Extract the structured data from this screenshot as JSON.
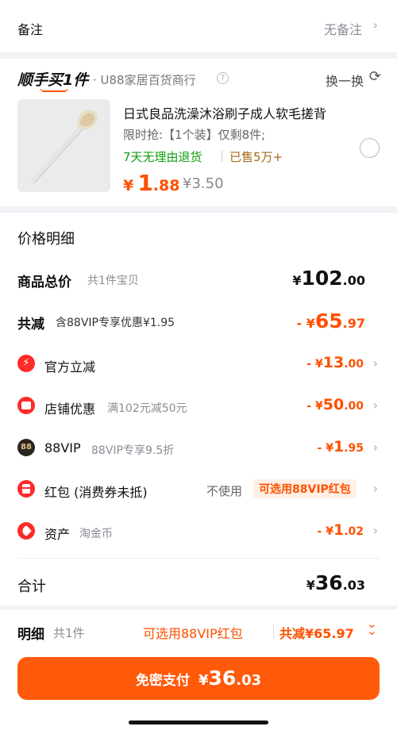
{
  "remark": {
    "label": "备注",
    "value": "无备注"
  },
  "store": {
    "logo_text": "顺手买1件",
    "name": "· U88家居百货商行",
    "swap_label": "换一换"
  },
  "product": {
    "title": "日式良品洗澡沐浴刷子成人软毛搓背",
    "promo": "限时抢:【1个装】仅剩8件;",
    "return_policy": "7天无理由退货",
    "sold": "已售5万+",
    "price_symbol": "¥",
    "price_int": "1",
    "price_dec": ".88",
    "original_price": "¥3.50"
  },
  "price_detail": {
    "heading": "价格明细",
    "total_label": "商品总价",
    "total_sub": "共1件宝贝",
    "total_symbol": "¥",
    "total_int": "102",
    "total_dec": ".00",
    "reduce_label": "共减",
    "reduce_sub": "含88VIP专享优惠¥1.95",
    "reduce_prefix": "- ¥",
    "reduce_int": "65",
    "reduce_dec": ".97",
    "official_label": "官方立减",
    "official_prefix": "- ¥",
    "official_int": "13",
    "official_dec": ".00",
    "shop_label": "店铺优惠",
    "shop_sub": "满102元减50元",
    "shop_prefix": "- ¥",
    "shop_int": "50",
    "shop_dec": ".00",
    "vip_badge": "88",
    "vip_label": "88VIP",
    "vip_sub": "88VIP专享9.5折",
    "vip_prefix": "- ¥",
    "vip_int": "1",
    "vip_dec": ".95",
    "redpacket_label": "红包 (消费券未抵)",
    "redpacket_value": "不使用",
    "redpacket_tag": "可选用88VIP红包",
    "asset_label": "资产",
    "asset_sub": "淘金币",
    "asset_prefix": "- ¥",
    "asset_int": "1",
    "asset_dec": ".02",
    "sum_label": "合计",
    "sum_symbol": "¥",
    "sum_int": "36",
    "sum_dec": ".03"
  },
  "bottom_bar": {
    "detail_label": "明细",
    "detail_sub": "共1件",
    "redpacket_hint": "可选用88VIP红包",
    "reduce_text": "共减¥65.97",
    "pay_label": "免密支付",
    "pay_symbol": "¥",
    "pay_int": "36",
    "pay_dec": ".03"
  },
  "colors": {
    "accent": "#ff5000",
    "green": "#11a011",
    "brown": "#a36a16",
    "red_icon": "#ff2b2b"
  }
}
